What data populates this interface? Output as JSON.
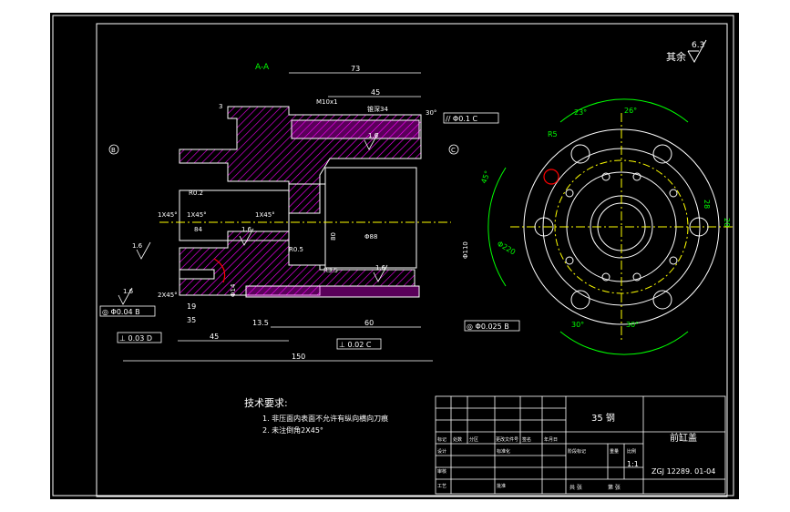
{
  "section_label": "A-A",
  "roughness_note": {
    "prefix": "其余",
    "value": "6.3"
  },
  "dimensions": {
    "d73": "73",
    "d45": "45",
    "d150": "150",
    "d60": "60",
    "d35": "35",
    "d13_5": "13.5",
    "d19": "19",
    "d3": "3",
    "d30": "30",
    "d80": "80",
    "m10": "M10x1",
    "thread34": "锥深34",
    "ch1": "1X45°",
    "ch2": "2X45°",
    "r0_5": "R0.5",
    "r5": "R5",
    "r3_5": "R3.5",
    "r0_2": "R0.2",
    "dia110": "Φ110",
    "dia88": "Φ88",
    "dia14": "Φ14",
    "dia84": "84",
    "deg30": "30°",
    "deg26": "26°",
    "deg23": "23°",
    "deg45": "45°",
    "dia220": "Φ220",
    "d28": "28",
    "d20": "20"
  },
  "tolerances": {
    "parallel": "// Φ0.1 C",
    "perp1": "⊥ 0.03 D",
    "perp2": "⊥ 0.02 C",
    "runout": "◎ Φ0.04 B",
    "coax": "◎ Φ0.025 B"
  },
  "datums": {
    "b": "B",
    "c": "C",
    "d": "D"
  },
  "surface_marks": {
    "s16a": "1.6",
    "s16b": "1.6",
    "s16c": "1.6",
    "s16d": "1.6",
    "s16e": "1.6"
  },
  "tech_requirements": {
    "title": "技术要求:",
    "items": [
      "1. 非压面内表面不允许有纵向横向刀痕",
      "2. 未注倒角2X45°"
    ]
  },
  "title_block": {
    "material": "35 钢",
    "part_name": "前缸盖",
    "drawing_no": "ZGJ 12289. 01-04",
    "scale": "1:1",
    "labels": {
      "mark": "标记",
      "count": "处数",
      "zone": "分区",
      "change_doc": "更改文件号",
      "sign": "签名",
      "date": "年月日",
      "design": "设计",
      "standard": "标准化",
      "stage_mark": "阶段标记",
      "weight": "重量",
      "ratio": "比例",
      "review": "审核",
      "process": "工艺",
      "approve": "批准",
      "sheets": "共 张",
      "sheet": "第 张"
    }
  }
}
